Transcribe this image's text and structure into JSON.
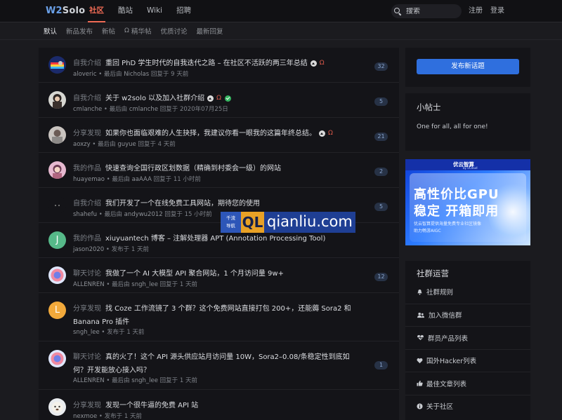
{
  "header": {
    "logo_a": "W2",
    "logo_b": "Solo",
    "nav": [
      "社区",
      "酷站",
      "Wiki",
      "招聘"
    ],
    "search_placeholder": "搜索",
    "register": "注册",
    "login": "登录"
  },
  "subnav": [
    "默认",
    "新品发布",
    "新帖",
    "精华帖",
    "优质讨论",
    "最新回复"
  ],
  "topics": [
    {
      "category": "自我介绍",
      "title": "重回 PhD 学生时代的自我迭代之路 – 在社区不活跃的两三年总结",
      "author": "aloveric",
      "sep": "•",
      "action": "最后由",
      "last_user": "Nicholas",
      "verb": "回复于",
      "time": "9 天前",
      "count": "32"
    },
    {
      "category": "自我介绍",
      "title": "关于 w2solo 以及加入社群介绍",
      "author": "cmlanche",
      "sep": "•",
      "action": "最后由",
      "last_user": "cmlanche",
      "verb": "回复于",
      "time": "2020年07月25日",
      "count": "5"
    },
    {
      "category": "分享发现",
      "title": "如果你也面临艰难的人生抉择，我建议你看一眼我的这篇年终总结。",
      "author": "aoxzy",
      "sep": "•",
      "action": "最后由",
      "last_user": "guyue",
      "verb": "回复于",
      "time": "4 天前",
      "count": "21"
    },
    {
      "category": "我的作品",
      "title": "快速查询全国行政区划数据（精确到村委会一级）的网站",
      "author": "huayemao",
      "sep": "•",
      "action": "最后由",
      "last_user": "aaAAA",
      "verb": "回复于",
      "time": "11 小时前",
      "count": "2"
    },
    {
      "category": "自我介绍",
      "title": "我们开发了一个在线免费工具网站，期待您的使用",
      "author": "shahefu",
      "sep": "•",
      "action": "最后由",
      "last_user": "andywu2012",
      "verb": "回复于",
      "time": "15 小时前",
      "count": "5"
    },
    {
      "category": "我的作品",
      "title": "xiuyuantech 博客 – 注解处理器 APT (Annotation Processing Tool)",
      "author": "jason2020",
      "sep": "•",
      "action": "",
      "last_user": "",
      "verb": "发布于",
      "time": "1 天前",
      "count": ""
    },
    {
      "category": "聊天讨论",
      "title": "我做了一个 AI 大模型 API 聚合网站，1 个月访问量 9w+",
      "author": "ALLENREN",
      "sep": "•",
      "action": "最后由",
      "last_user": "sngh_lee",
      "verb": "回复于",
      "time": "1 天前",
      "count": "12"
    },
    {
      "category": "分享发现",
      "title": "找 Coze 工作流镜了 3 个群？这个免费网站直接打包 200+，还能薅 Sora2 和 Banana Pro 插件",
      "author": "sngh_lee",
      "sep": "•",
      "action": "",
      "last_user": "",
      "verb": "发布于",
      "time": "1 天前",
      "count": ""
    },
    {
      "category": "聊天讨论",
      "title": "真的火了！这个 API 源头供应站月访问量 10W，Sora2–0.08/条稳定性到底如何？开发能放心接入吗？",
      "author": "ALLENREN",
      "sep": "•",
      "action": "最后由",
      "last_user": "sngh_lee",
      "verb": "回复于",
      "time": "1 天前",
      "count": "1"
    },
    {
      "category": "分享发现",
      "title": "发现一个很牛逼的免费 API 站",
      "author": "nexmoe",
      "sep": "•",
      "action": "",
      "last_user": "",
      "verb": "发布于",
      "time": "1 天前",
      "count": ""
    }
  ],
  "sidebar": {
    "new_topic": "发布新话题",
    "tips_title": "小帖士",
    "tips_text": "One for all, all for one!",
    "ops_title": "社群运营",
    "ops": [
      "社群规则",
      "加入微信群",
      "群员产品列表",
      "国外Hacker列表",
      "最佳文章列表",
      "关于社区"
    ]
  },
  "ad": {
    "brand": "优云智算",
    "brand_sub": "by UCloud",
    "line1": "高性价比GPU",
    "line2": "稳定 开箱即用",
    "line3": "优云智算提供海量免费专业社区镜像",
    "line4": "助力畅游AIGC"
  },
  "watermark": {
    "cn1": "千流",
    "cn2": "导航",
    "ql": "QL",
    "site": "qianliu.com"
  },
  "colors": {
    "accent": "#f06b55",
    "primary_button": "#2f6fde",
    "badge_bg": "#273246",
    "badge_text": "#8aa6cf"
  }
}
